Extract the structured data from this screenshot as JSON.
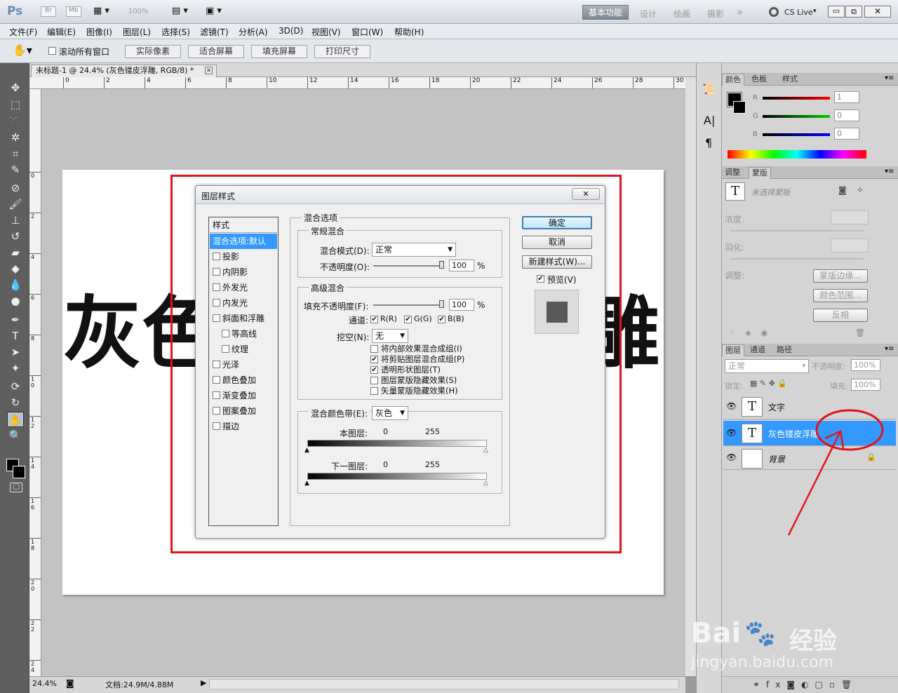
{
  "app": {
    "logo": "Ps",
    "badges": [
      "Br",
      "Mb"
    ],
    "zoom": "100%",
    "workspaces": [
      "基本功能",
      "设计",
      "绘画",
      "摄影"
    ],
    "more": "»",
    "cslive": "CS Live"
  },
  "menu": [
    "文件(F)",
    "编辑(E)",
    "图像(I)",
    "图层(L)",
    "选择(S)",
    "滤镜(T)",
    "分析(A)",
    "3D(D)",
    "视图(V)",
    "窗口(W)",
    "帮助(H)"
  ],
  "options": {
    "scroll_all": "滚动所有窗口",
    "buttons": [
      "实际像素",
      "适合屏幕",
      "填充屏幕",
      "打印尺寸"
    ]
  },
  "doc": {
    "tab": "未标题-1 @ 24.4% (灰色镂皮浮雕, RGB/8) *",
    "visible_left": "灰色",
    "visible_right": "雕"
  },
  "ruler_h": [
    "0",
    "2",
    "4",
    "6",
    "8",
    "10",
    "12",
    "14",
    "16",
    "18",
    "20",
    "22",
    "24",
    "26",
    "28",
    "30"
  ],
  "ruler_v": [
    "0",
    "2",
    "4",
    "6",
    "8",
    "1\n0",
    "1\n2",
    "1\n4",
    "1\n6",
    "1\n8",
    "2\n0",
    "2\n2",
    "2\n4"
  ],
  "status": {
    "zoom": "24.4%",
    "doc": "文档:24.9M/4.88M"
  },
  "dialog": {
    "title": "图层样式",
    "styles_header": "样式",
    "styles": [
      "混合选项:默认",
      "投影",
      "内阴影",
      "外发光",
      "内发光",
      "斜面和浮雕",
      "等高线",
      "纹理",
      "光泽",
      "颜色叠加",
      "渐变叠加",
      "图案叠加",
      "描边"
    ],
    "blend_options": "混合选项",
    "general": "常规混合",
    "blend_mode_label": "混合模式(D):",
    "blend_mode": "正常",
    "opacity_label": "不透明度(O):",
    "opacity": "100",
    "pct": "%",
    "advanced": "高级混合",
    "fill_label": "填充不透明度(F):",
    "fill": "100",
    "channels_label": "通道:",
    "ch_r": "R(R)",
    "ch_g": "G(G)",
    "ch_b": "B(B)",
    "knockout_label": "挖空(N):",
    "knockout": "无",
    "checks": [
      "将内部效果混合成组(I)",
      "将剪贴图层混合成组(P)",
      "透明形状图层(T)",
      "图层蒙版隐藏效果(S)",
      "矢量蒙版隐藏效果(H)"
    ],
    "checks_state": [
      false,
      true,
      true,
      false,
      false
    ],
    "blend_if_label": "混合颜色带(E):",
    "blend_if": "灰色",
    "this_layer": "本图层:",
    "underlying": "下一图层:",
    "v0": "0",
    "v255": "255",
    "ok": "确定",
    "cancel": "取消",
    "new_style": "新建样式(W)...",
    "preview": "预览(V)"
  },
  "color_panel": {
    "tabs": [
      "颜色",
      "色板",
      "样式"
    ],
    "r_lbl": "R",
    "g_lbl": "G",
    "b_lbl": "B",
    "r": "1",
    "g": "0",
    "b": "0"
  },
  "adjust_panel": {
    "tabs": [
      "调整",
      "蒙版"
    ],
    "no_mask": "未选择蒙版",
    "density": "浓度:",
    "feather": "羽化:",
    "refine": "调整:",
    "btns": [
      "蒙版边缘...",
      "颜色范围...",
      "反相"
    ]
  },
  "layers_panel": {
    "tabs": [
      "图层",
      "通道",
      "路径"
    ],
    "mode": "正常",
    "opacity_label": "不透明度:",
    "opacity": "100%",
    "lock_label": "锁定:",
    "fill_label": "填充:",
    "fill": "100%",
    "layers": [
      {
        "name": "文字",
        "thumb": "T"
      },
      {
        "name": "灰色镂皮浮雕",
        "thumb": "T"
      },
      {
        "name": "背景",
        "thumb": ""
      }
    ]
  },
  "watermark": {
    "brand": "Bai",
    "brand2": "经验",
    "url": "jingyan.baidu.com"
  },
  "colors": {
    "accent": "#3399ff",
    "annotation": "#e0141c"
  }
}
